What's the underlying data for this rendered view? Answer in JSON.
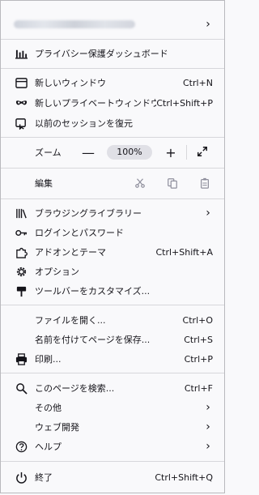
{
  "account": {
    "blurred_email": true
  },
  "items": {
    "privacy_dashboard": "プライバシー保護ダッシュボード",
    "new_window": {
      "label": "新しいウィンドウ",
      "shortcut": "Ctrl+N"
    },
    "new_private_window": {
      "label": "新しいプライベートウィンドウ",
      "shortcut": "Ctrl+Shift+P"
    },
    "restore_session": "以前のセッションを復元",
    "zoom": {
      "label": "ズーム",
      "minus": "—",
      "value": "100%",
      "plus": "+"
    },
    "edit": "編集",
    "library": "ブラウジングライブラリー",
    "logins": "ログインとパスワード",
    "addons": {
      "label": "アドオンとテーマ",
      "shortcut": "Ctrl+Shift+A"
    },
    "options": "オプション",
    "customize": "ツールバーをカスタマイズ...",
    "open_file": {
      "label": "ファイルを開く...",
      "shortcut": "Ctrl+O"
    },
    "save_page": {
      "label": "名前を付けてページを保存...",
      "shortcut": "Ctrl+S"
    },
    "print": {
      "label": "印刷...",
      "shortcut": "Ctrl+P"
    },
    "find": {
      "label": "このページを検索...",
      "shortcut": "Ctrl+F"
    },
    "more": "その他",
    "web_dev": "ウェブ開発",
    "help": "ヘルプ",
    "quit": {
      "label": "終了",
      "shortcut": "Ctrl+Shift+Q"
    }
  },
  "chevron": "›"
}
